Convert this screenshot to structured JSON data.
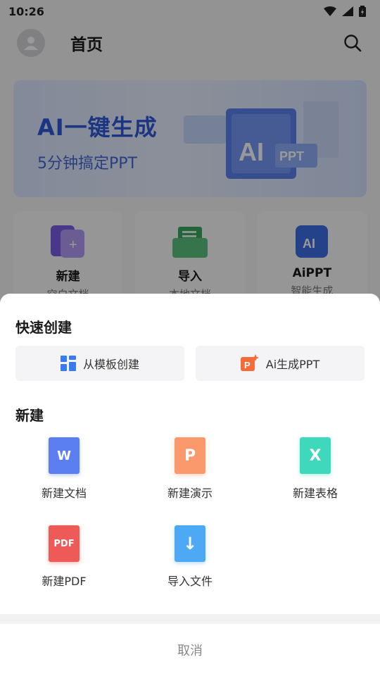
{
  "status": {
    "time": "10:26"
  },
  "header": {
    "title": "首页"
  },
  "banner": {
    "title": "AI一键生成",
    "subtitle": "5分钟搞定PPT",
    "art_ai": "AI",
    "art_ppt": "PPT"
  },
  "features": [
    {
      "title": "新建",
      "subtitle": "空白文档"
    },
    {
      "title": "导入",
      "subtitle": "本地文档"
    },
    {
      "title": "AiPPT",
      "subtitle": "智能生成"
    }
  ],
  "sheet": {
    "quick_title": "快速创建",
    "quick_buttons": [
      {
        "label": "从模板创建",
        "icon": "template-grid-icon"
      },
      {
        "label": "Ai生成PPT",
        "icon": "ai-ppt-icon"
      }
    ],
    "new_title": "新建",
    "new_items": [
      {
        "label": "新建文档",
        "glyph": "W",
        "color": "#5b7ff0"
      },
      {
        "label": "新建演示",
        "glyph": "P",
        "color": "#fa9a6c"
      },
      {
        "label": "新建表格",
        "glyph": "X",
        "color": "#3fd8bd"
      },
      {
        "label": "新建PDF",
        "glyph": "PDF",
        "color": "#ee5a57"
      },
      {
        "label": "导入文件",
        "glyph": "↓",
        "color": "#4ea9f5"
      }
    ],
    "cancel_label": "取消"
  }
}
